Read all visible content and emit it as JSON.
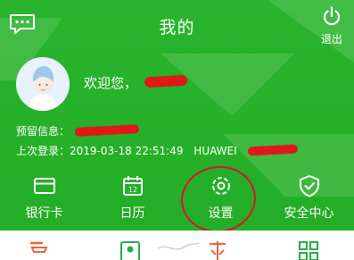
{
  "header": {
    "title": "我的",
    "logout_label": "退出",
    "message_icon": "chat-bubble-icon",
    "logout_icon": "power-icon"
  },
  "profile": {
    "welcome": "欢迎您，",
    "reserved_label": "预留信息：",
    "last_login_label": "上次登录：",
    "last_login_time": "2019-03-18 22:51:49",
    "device": "HUAWEI"
  },
  "actions": [
    {
      "label": "银行卡",
      "icon": "bank-card-icon"
    },
    {
      "label": "日历",
      "icon": "calendar-icon"
    },
    {
      "label": "设置",
      "icon": "gear-icon"
    },
    {
      "label": "安全中心",
      "icon": "shield-check-icon"
    }
  ],
  "calendar_day": "12",
  "colors": {
    "brand_green": "#26b12a",
    "redaction_red": "#e01818",
    "annotation_red": "#d8152a",
    "icon_orange": "#e8643c",
    "icon_green": "#2aa84a"
  }
}
